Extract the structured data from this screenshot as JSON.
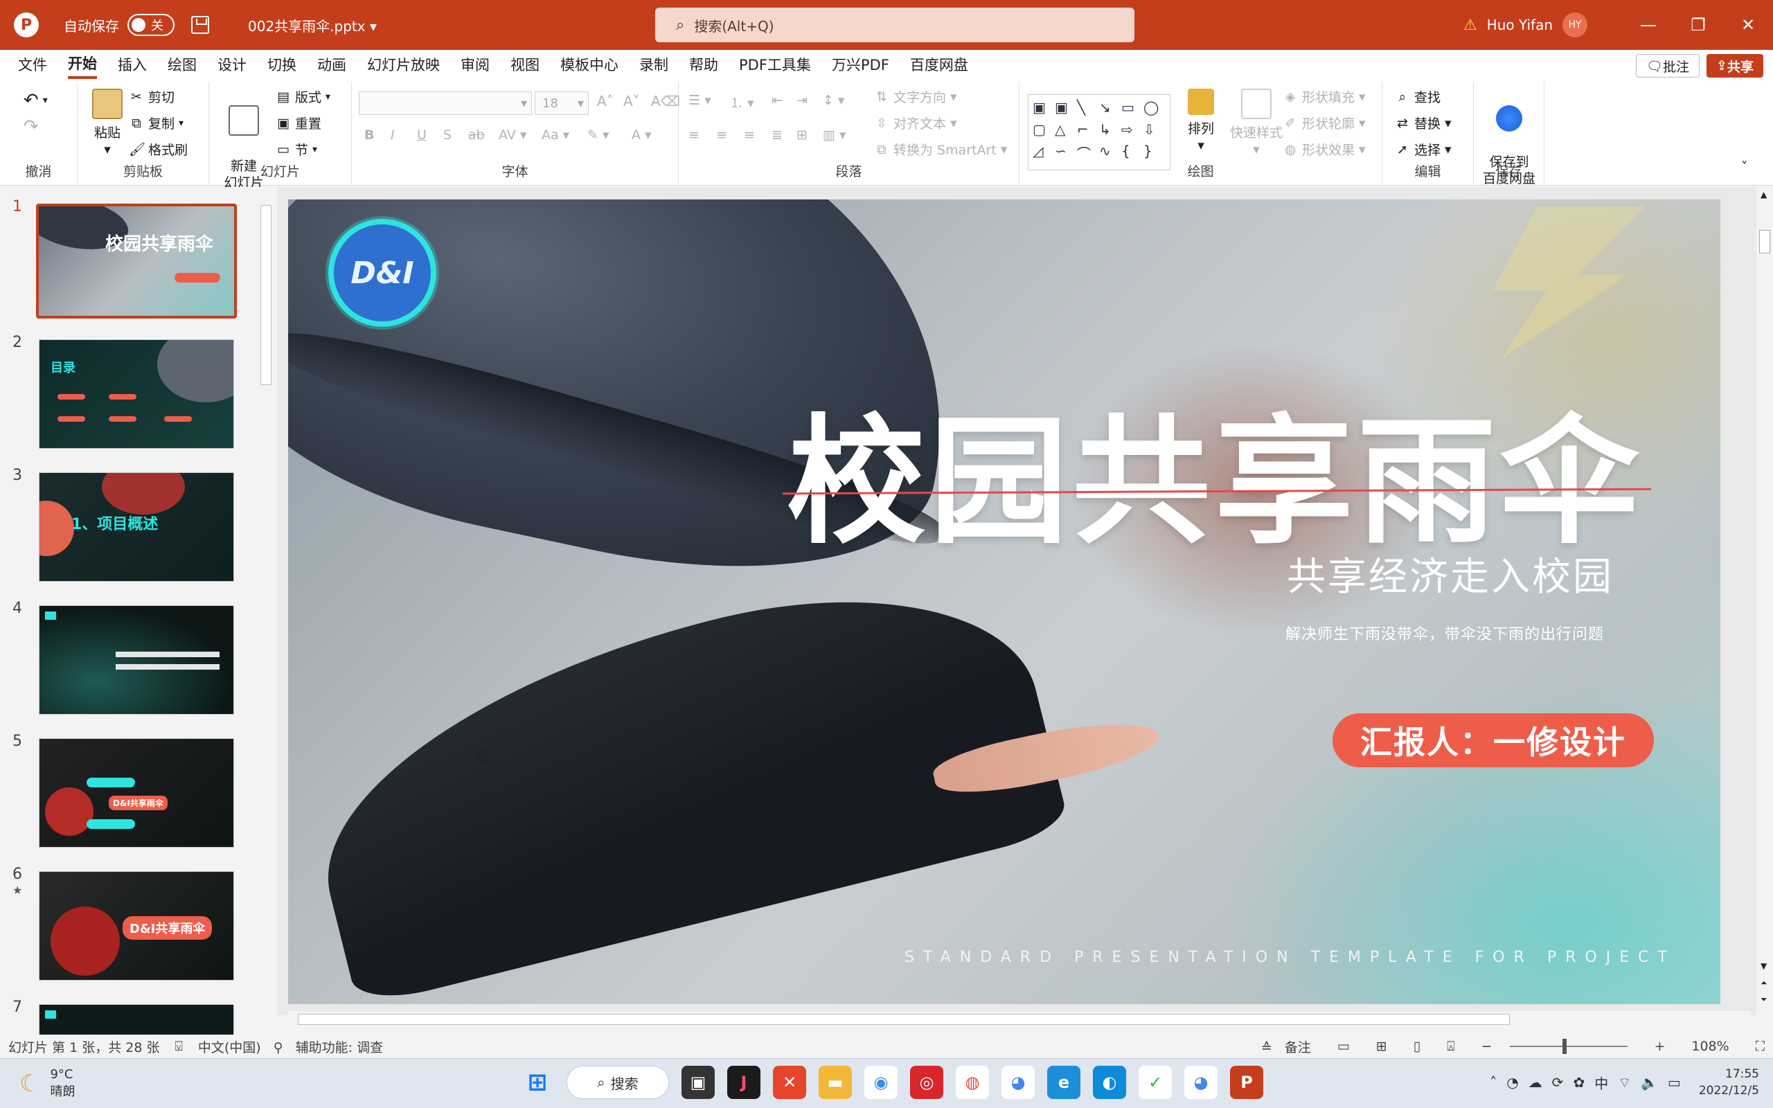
{
  "titlebar": {
    "autosave_label": "自动保存",
    "autosave_state": "关",
    "filename": "002共享雨伞.pptx",
    "search_placeholder": "搜索(Alt+Q)",
    "user_name": "Huo Yifan",
    "user_initials": "HY"
  },
  "tabs": [
    "文件",
    "开始",
    "插入",
    "绘图",
    "设计",
    "切换",
    "动画",
    "幻灯片放映",
    "审阅",
    "视图",
    "模板中心",
    "录制",
    "帮助",
    "PDF工具集",
    "万兴PDF",
    "百度网盘"
  ],
  "active_tab": "开始",
  "actions": {
    "comment": "批注",
    "share": "共享"
  },
  "ribbon": {
    "undo": {
      "label": "撤消"
    },
    "clipboard": {
      "label": "剪贴板",
      "paste": "粘贴",
      "cut": "剪切",
      "copy": "复制",
      "format_painter": "格式刷"
    },
    "slides": {
      "label": "幻灯片",
      "new_slide": "新建\n幻灯片",
      "layout": "版式",
      "reset": "重置",
      "section": "节"
    },
    "font": {
      "label": "字体",
      "size": "18"
    },
    "paragraph": {
      "label": "段落",
      "text_direction": "文字方向",
      "align_text": "对齐文本",
      "convert_smartart": "转换为 SmartArt"
    },
    "drawing": {
      "label": "绘图",
      "arrange": "排列",
      "quick_styles": "快速样式",
      "shape_fill": "形状填充",
      "shape_outline": "形状轮廓",
      "shape_effects": "形状效果"
    },
    "editing": {
      "label": "编辑",
      "find": "查找",
      "replace": "替换",
      "select": "选择"
    },
    "save": {
      "label": "保存",
      "save_baidu": "保存到\n百度网盘"
    }
  },
  "thumbnails": [
    {
      "num": "1",
      "title": "校园共享雨伞"
    },
    {
      "num": "2",
      "title": "目录"
    },
    {
      "num": "3",
      "title": "1、项目概述"
    },
    {
      "num": "4",
      "title": ""
    },
    {
      "num": "5",
      "title": "D&I共享雨伞"
    },
    {
      "num": "6",
      "title": "D&I共享雨伞"
    },
    {
      "num": "7",
      "title": ""
    }
  ],
  "slide": {
    "logo_text": "D&I",
    "title": "校园共享雨伞",
    "subtitle": "共享经济走入校园",
    "description": "解决师生下雨没带伞，带伞没下雨的出行问题",
    "presenter": "汇报人：一修设计",
    "footer_english": "STANDARD PRESENTATION TEMPLATE FOR PROJECT"
  },
  "status": {
    "slide_info": "幻灯片 第 1 张，共 28 张",
    "language": "中文(中国)",
    "accessibility": "辅助功能: 调查",
    "notes": "备注",
    "zoom": "108%"
  },
  "taskbar": {
    "temperature": "9°C",
    "weather": "晴朗",
    "search_label": "搜索",
    "ime": "中",
    "time": "17:55",
    "date": "2022/12/5"
  }
}
